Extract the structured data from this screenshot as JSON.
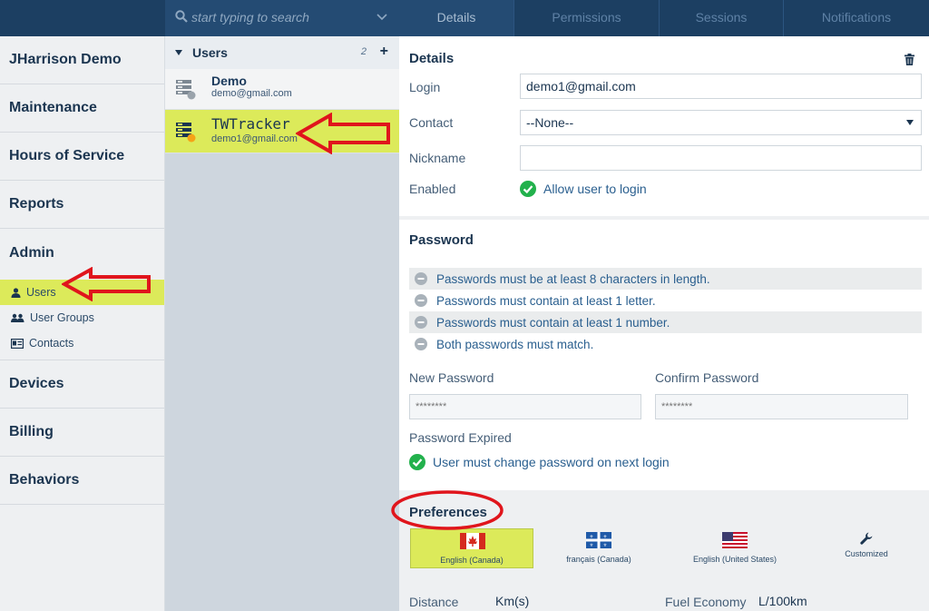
{
  "search": {
    "placeholder": "start typing to search"
  },
  "tabs": [
    {
      "label": "Details",
      "active": true
    },
    {
      "label": "Permissions",
      "active": false
    },
    {
      "label": "Sessions",
      "active": false
    },
    {
      "label": "Notifications",
      "active": false
    }
  ],
  "leftnav": {
    "account": "JHarrison Demo",
    "items": [
      "Maintenance",
      "Hours of Service",
      "Reports",
      "Admin"
    ],
    "admin_sub": [
      {
        "label": "Users",
        "icon": "user-icon",
        "selected": true
      },
      {
        "label": "User Groups",
        "icon": "user-group-icon",
        "selected": false
      },
      {
        "label": "Contacts",
        "icon": "contact-card-icon",
        "selected": false
      }
    ],
    "items_after": [
      "Devices",
      "Billing",
      "Behaviors"
    ]
  },
  "userlist": {
    "header": "Users",
    "count": "2",
    "add_label": "+",
    "users": [
      {
        "name": "Demo",
        "email": "demo@gmail.com",
        "status_color": "#9aa3ab",
        "selected": false
      },
      {
        "name": "TWTracker",
        "email": "demo1@gmail.com",
        "status_color": "#f5a316",
        "selected": true
      }
    ]
  },
  "details": {
    "title": "Details",
    "login_label": "Login",
    "login_value": "demo1@gmail.com",
    "contact_label": "Contact",
    "contact_value": "--None--",
    "nickname_label": "Nickname",
    "nickname_value": "",
    "enabled_label": "Enabled",
    "enabled_text": "Allow user to login"
  },
  "password": {
    "title": "Password",
    "rules": [
      "Passwords must be at least 8 characters in length.",
      "Passwords must contain at least 1 letter.",
      "Passwords must contain at least 1 number.",
      "Both passwords must match."
    ],
    "new_label": "New Password",
    "new_placeholder": "********",
    "confirm_label": "Confirm Password",
    "confirm_placeholder": "********",
    "expired_label": "Password Expired",
    "expired_text": "User must change password on next login"
  },
  "preferences": {
    "title": "Preferences",
    "locales": [
      {
        "label": "English (Canada)",
        "icon": "canada-flag-icon",
        "selected": true
      },
      {
        "label": "français (Canada)",
        "icon": "quebec-flag-icon",
        "selected": false
      },
      {
        "label": "English (United States)",
        "icon": "us-flag-icon",
        "selected": false
      },
      {
        "label": "Customized",
        "icon": "wrench-icon",
        "selected": false
      }
    ],
    "distance_label": "Distance",
    "distance_value": "Km(s)",
    "fuel_label": "Fuel Economy",
    "fuel_value": "L/100km"
  },
  "colors": {
    "topbar": "#1c3f62",
    "highlight": "#dcea5a",
    "annotation": "#e0151c",
    "check_green": "#22b14c"
  }
}
